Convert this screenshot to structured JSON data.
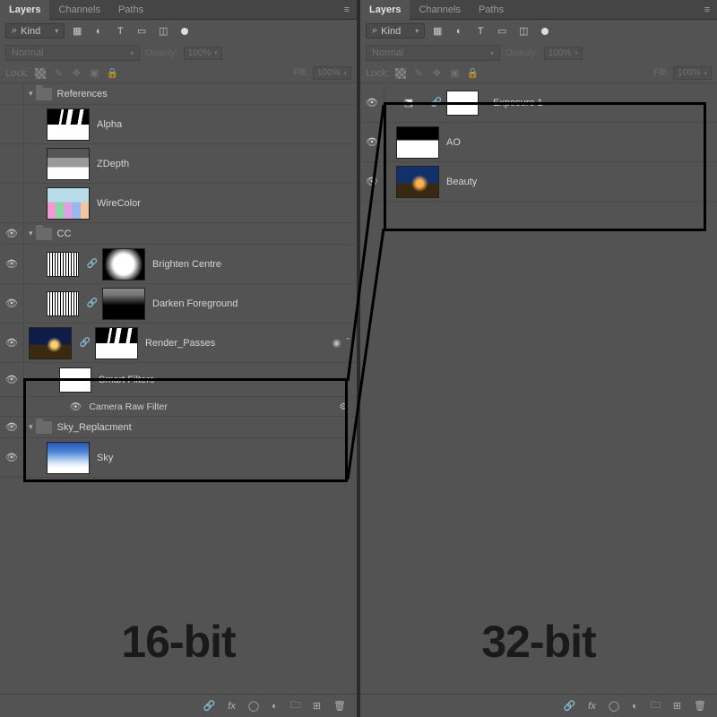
{
  "tabs": {
    "layers": "Layers",
    "channels": "Channels",
    "paths": "Paths"
  },
  "filter": {
    "kind_label": "Kind",
    "search_glyph": "⌕"
  },
  "mode": {
    "blend": "Normal",
    "opacity_label": "Opacity:",
    "opacity_value": "100%"
  },
  "lock": {
    "label": "Lock:",
    "fill_label": "Fill:",
    "fill_value": "100%"
  },
  "left": {
    "groups": {
      "references": "References",
      "cc": "CC",
      "sky_replacement": "Sky_Replacment"
    },
    "layers": {
      "alpha": "Alpha",
      "zdepth": "ZDepth",
      "wirecolor": "WireColor",
      "brighten_centre": "Brighten Centre",
      "darken_foreground": "Darken Foreground",
      "render_passes": "Render_Passes",
      "smart_filters": "Smart Filters",
      "camera_raw_filter": "Camera Raw Filter",
      "sky": "Sky"
    },
    "biglabel": "16-bit"
  },
  "right": {
    "layers": {
      "exposure1": "Exposure 1",
      "ao": "AO",
      "beauty": "Beauty"
    },
    "biglabel": "32-bit"
  }
}
